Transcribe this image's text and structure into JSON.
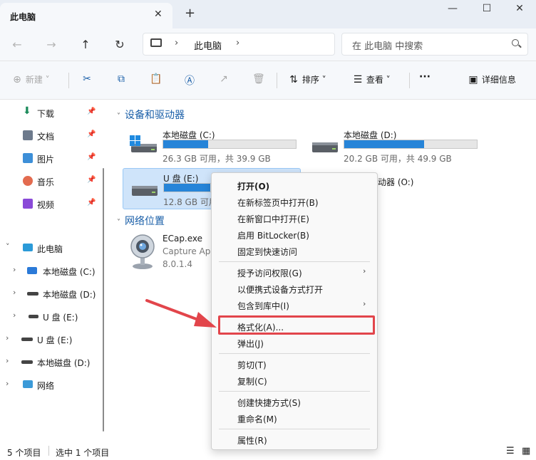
{
  "window": {
    "tab_title": "此电脑",
    "tab_close": "✕",
    "tab_add": "+",
    "minimize": "—",
    "maximize": "☐",
    "close": "✕"
  },
  "nav": {
    "back": "←",
    "forward": "→",
    "up": "↑",
    "refresh": "↻",
    "address_sep1": "›",
    "address_text": "此电脑",
    "address_sep2": "›",
    "search_placeholder": "在 此电脑 中搜索"
  },
  "toolbar": {
    "new_label": "新建",
    "new_chevron": "˅",
    "sort_label": "排序",
    "sort_chevron": "˅",
    "view_label": "查看",
    "view_chevron": "˅",
    "more": "···",
    "details_label": "详细信息"
  },
  "sidebar": {
    "quick_access": [
      {
        "label": "下载",
        "pin": "📌"
      },
      {
        "label": "文档",
        "pin": "📌"
      },
      {
        "label": "图片",
        "pin": "📌"
      },
      {
        "label": "音乐",
        "pin": "📌"
      },
      {
        "label": "视频",
        "pin": "📌"
      }
    ],
    "tree": [
      {
        "label": "此电脑",
        "chevron": "˅"
      },
      {
        "label": "本地磁盘 (C:)",
        "chevron": "›"
      },
      {
        "label": "本地磁盘 (D:)",
        "chevron": "›"
      },
      {
        "label": "U 盘 (E:)",
        "chevron": "›"
      },
      {
        "label": "U 盘 (E:)",
        "chevron": "›"
      },
      {
        "label": "本地磁盘 (D:)",
        "chevron": "›"
      },
      {
        "label": "网络",
        "chevron": "›"
      }
    ]
  },
  "content": {
    "devices_header": "设备和驱动器",
    "network_header": "网络位置",
    "caret": "˅",
    "drives": [
      {
        "name": "本地磁盘 (C:)",
        "info": "26.3 GB 可用，共 39.9 GB",
        "used_fraction": 0.34
      },
      {
        "name": "本地磁盘 (D:)",
        "info": "20.2 GB 可用，共 49.9 GB",
        "used_fraction": 0.6
      },
      {
        "name": "U 盘 (E:)",
        "info": "12.8 GB 可用",
        "used_fraction": 0.55
      },
      {
        "name": "动器 (O:)"
      }
    ],
    "network_item": {
      "name": "ECap.exe",
      "sub": "Capture App",
      "version": "8.0.1.4"
    }
  },
  "context_menu": {
    "items": [
      {
        "label": "打开(O)",
        "bold": true
      },
      {
        "label": "在新标签页中打开(B)"
      },
      {
        "label": "在新窗口中打开(E)"
      },
      {
        "label": "启用 BitLocker(B)"
      },
      {
        "label": "固定到快速访问"
      },
      {
        "label": "授予访问权限(G)",
        "submenu": true
      },
      {
        "label": "以便携式设备方式打开"
      },
      {
        "label": "包含到库中(I)",
        "submenu": true
      },
      {
        "label": "格式化(A)...",
        "highlighted": true
      },
      {
        "label": "弹出(J)"
      },
      {
        "label": "剪切(T)"
      },
      {
        "label": "复制(C)"
      },
      {
        "label": "创建快捷方式(S)"
      },
      {
        "label": "重命名(M)"
      },
      {
        "label": "属性(R)"
      }
    ],
    "submenu_arrow": "›"
  },
  "status": {
    "item_count": "5 个项目",
    "selected_count": "选中 1 个项目"
  },
  "colors": {
    "accent": "#2684d8",
    "highlight_box": "#e2454b",
    "arrow": "#e2454b",
    "selected_bg": "#cfe4fa"
  }
}
